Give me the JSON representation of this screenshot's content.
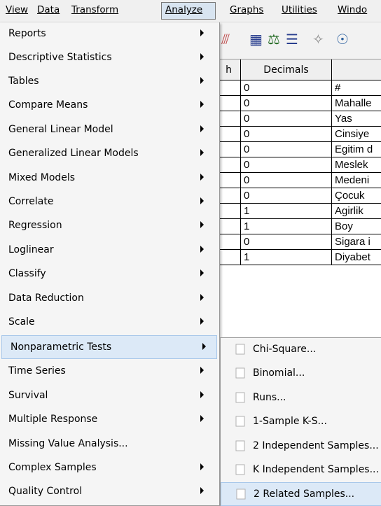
{
  "menubar": {
    "items": [
      "View",
      "Data",
      "Transform",
      "Analyze",
      "Graphs",
      "Utilities",
      "Windo"
    ],
    "active": "Analyze"
  },
  "toolbar": {
    "icons": [
      "variables-icon",
      "select-cases-icon",
      "weight-cases-icon",
      "value-labels-icon",
      "use-sets-icon",
      "find-icon"
    ]
  },
  "grid": {
    "headers": [
      "h",
      "Decimals",
      ""
    ],
    "rows": [
      {
        "decimals": "0",
        "label": "#"
      },
      {
        "decimals": "0",
        "label": "Mahalle"
      },
      {
        "decimals": "0",
        "label": "Yas"
      },
      {
        "decimals": "0",
        "label": "Cinsiye"
      },
      {
        "decimals": "0",
        "label": "Egitim d"
      },
      {
        "decimals": "0",
        "label": "Meslek"
      },
      {
        "decimals": "0",
        "label": "Medeni"
      },
      {
        "decimals": "0",
        "label": "Çocuk"
      },
      {
        "decimals": "1",
        "label": "Agirlik"
      },
      {
        "decimals": "1",
        "label": "Boy"
      },
      {
        "decimals": "0",
        "label": "Sigara i"
      },
      {
        "decimals": "1",
        "label": "Diyabet"
      }
    ]
  },
  "analyze_menu": {
    "items": [
      {
        "label": "Reports",
        "submenu": true
      },
      {
        "label": "Descriptive Statistics",
        "submenu": true
      },
      {
        "label": "Tables",
        "submenu": true
      },
      {
        "label": "Compare Means",
        "submenu": true
      },
      {
        "label": "General Linear Model",
        "submenu": true
      },
      {
        "label": "Generalized Linear Models",
        "submenu": true
      },
      {
        "label": "Mixed Models",
        "submenu": true
      },
      {
        "label": "Correlate",
        "submenu": true
      },
      {
        "label": "Regression",
        "submenu": true
      },
      {
        "label": "Loglinear",
        "submenu": true
      },
      {
        "label": "Classify",
        "submenu": true
      },
      {
        "label": "Data Reduction",
        "submenu": true
      },
      {
        "label": "Scale",
        "submenu": true
      },
      {
        "label": "Nonparametric Tests",
        "submenu": true
      },
      {
        "label": "Time Series",
        "submenu": true
      },
      {
        "label": "Survival",
        "submenu": true
      },
      {
        "label": "Multiple Response",
        "submenu": true
      },
      {
        "label": "Missing Value Analysis...",
        "submenu": false
      },
      {
        "label": "Complex Samples",
        "submenu": true
      },
      {
        "label": "Quality Control",
        "submenu": true
      }
    ],
    "highlighted": "Nonparametric Tests"
  },
  "nonparametric_submenu": {
    "items": [
      {
        "label": "Chi-Square...",
        "icon": "chi-square-icon"
      },
      {
        "label": "Binomial...",
        "icon": "binomial-icon"
      },
      {
        "label": "Runs...",
        "icon": "runs-icon"
      },
      {
        "label": "1-Sample K-S...",
        "icon": "one-sample-ks-icon"
      },
      {
        "label": "2 Independent Samples...",
        "icon": "two-independent-samples-icon"
      },
      {
        "label": "K Independent Samples...",
        "icon": "k-independent-samples-icon"
      },
      {
        "label": "2 Related Samples...",
        "icon": "two-related-samples-icon"
      }
    ],
    "highlighted": "2 Related Samples..."
  },
  "colors": {
    "highlight_bg": "#dce9f7",
    "highlight_border": "#a7c7ea",
    "menu_bg": "#f5f5f5"
  }
}
